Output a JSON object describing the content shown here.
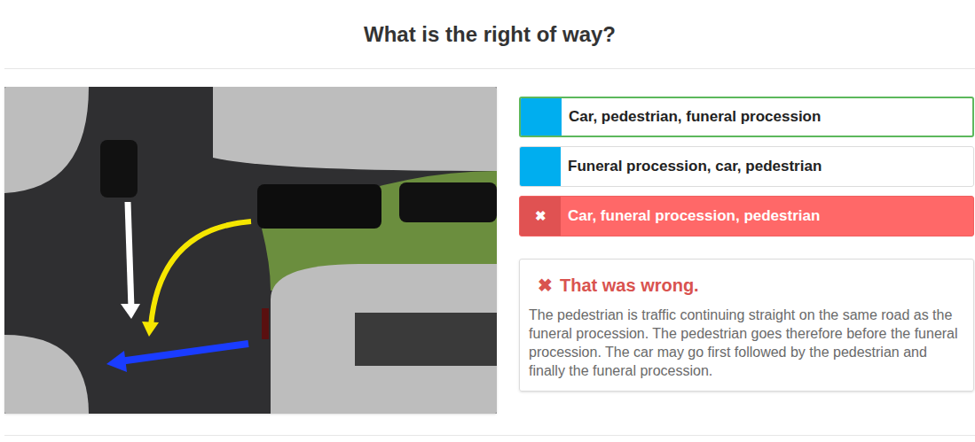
{
  "question": {
    "title": "What is the right of way?"
  },
  "options": [
    {
      "label": "Car, pedestrian, funeral procession",
      "selected": false,
      "correct": true,
      "mark": ""
    },
    {
      "label": "Funeral procession, car, pedestrian",
      "selected": false,
      "correct": false,
      "mark": ""
    },
    {
      "label": "Car, funeral procession, pedestrian",
      "selected": true,
      "correct": false,
      "mark": "✖"
    }
  ],
  "feedback": {
    "icon": "✖",
    "title": "That was wrong.",
    "text": "The pedestrian is traffic continuing straight on the same road as the funeral procession. The pedestrian goes therefore before the funeral procession. The car may go first followed by the pedestrian and finally the funeral procession."
  }
}
